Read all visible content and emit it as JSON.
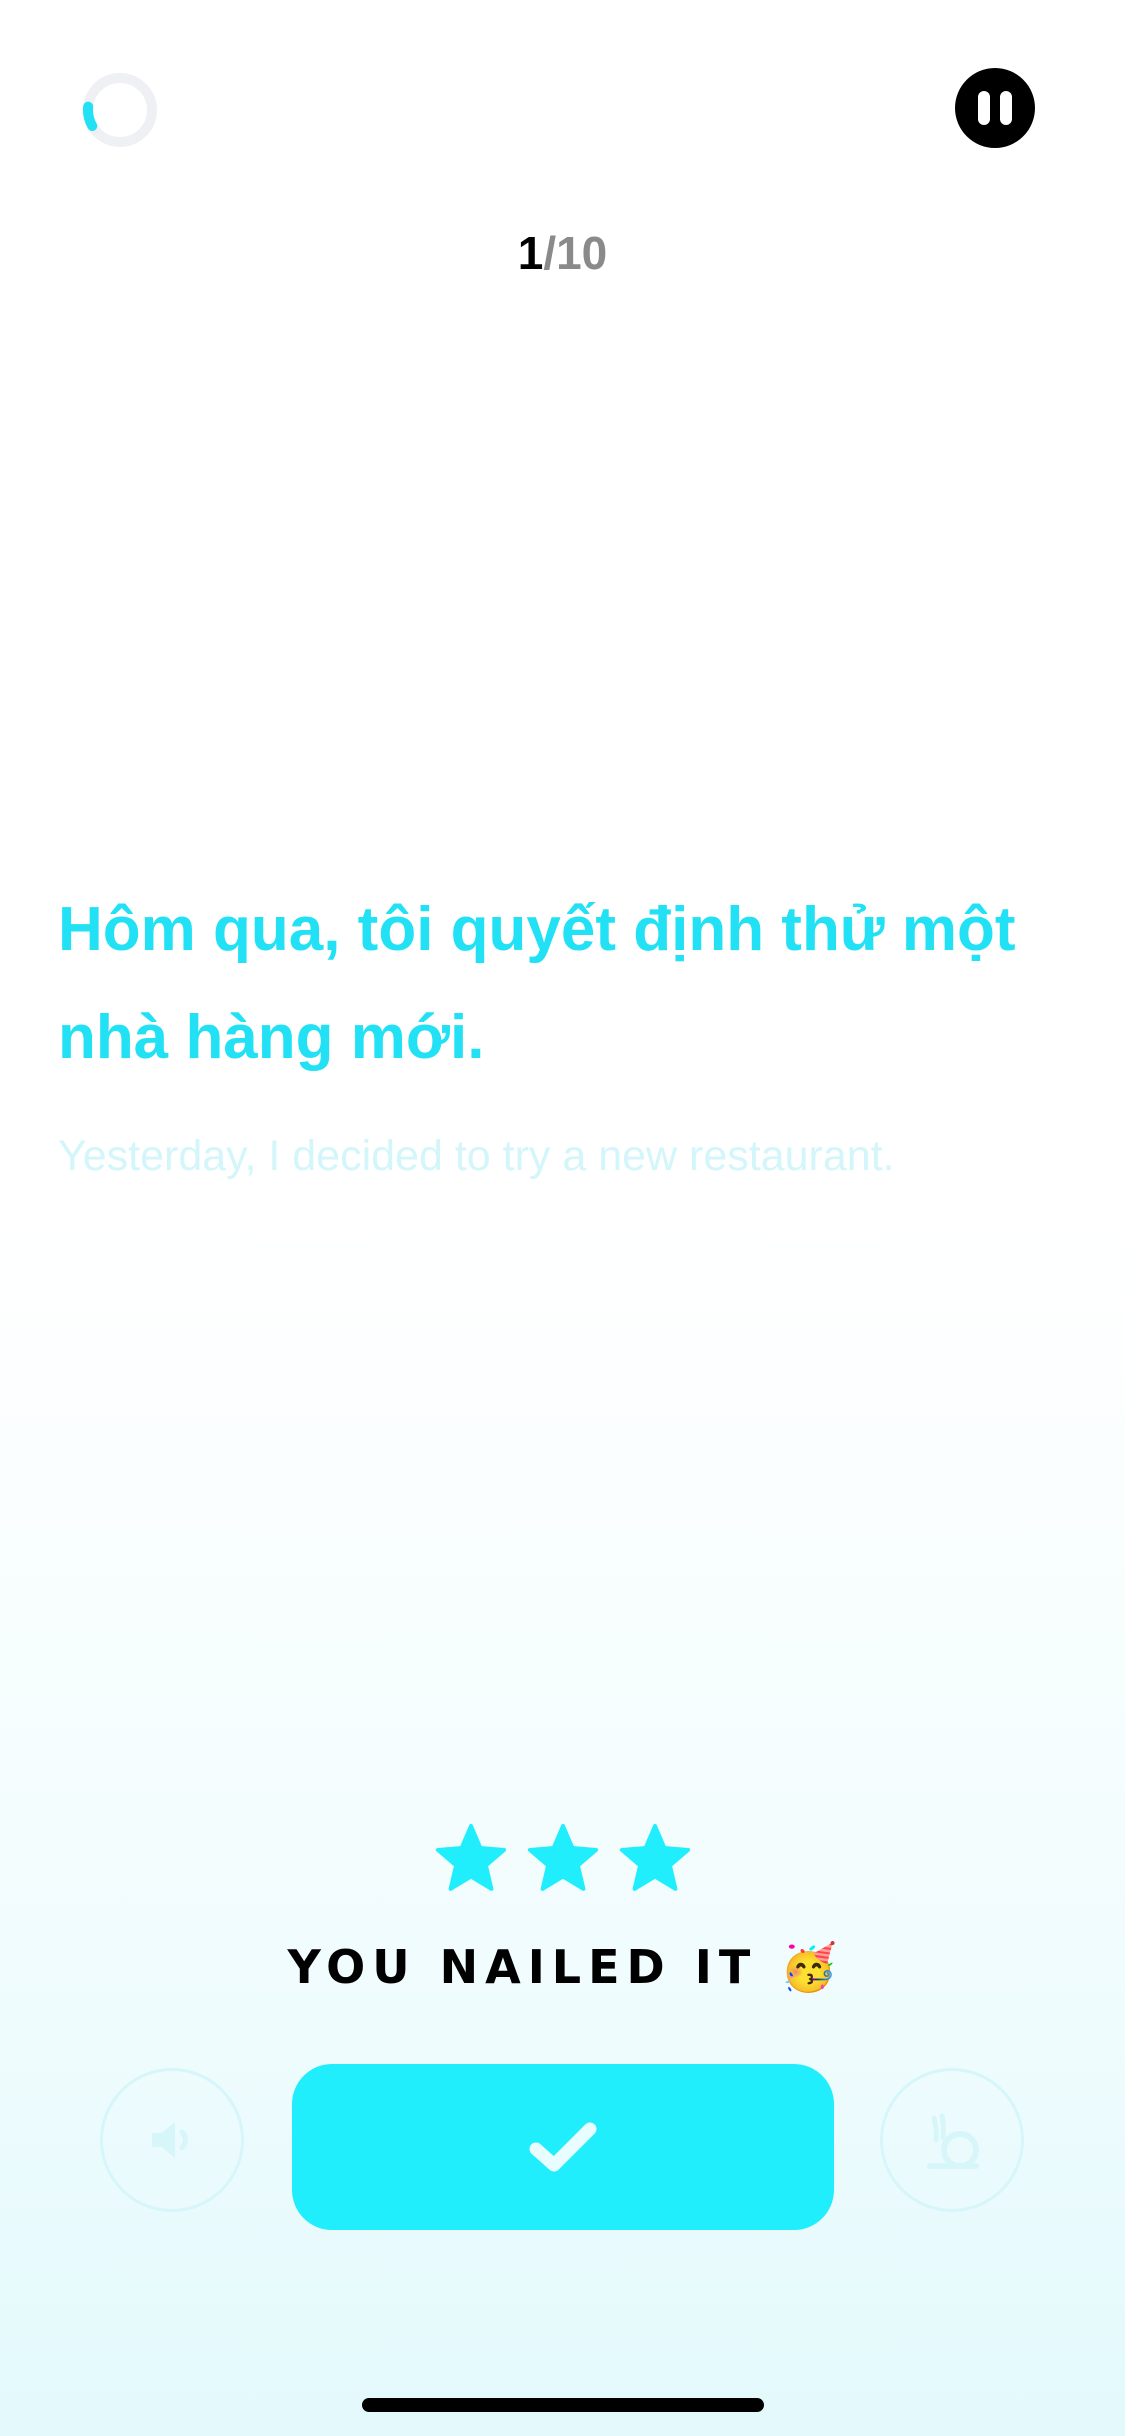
{
  "header": {
    "progress": 0.1,
    "current": "1",
    "separator": "/",
    "total": "10"
  },
  "sentence": {
    "text": "Hôm qua, tôi quyết định thử một nhà hàng mới.",
    "translation": "Yesterday, I decided to try a new restaurant."
  },
  "result": {
    "stars": 3,
    "message": "YOU NAILED IT",
    "emoji": "🥳"
  },
  "icons": {
    "progress": "progress-ring-icon",
    "pause": "pause-icon",
    "star": "star-icon",
    "audio": "speaker-icon",
    "slow": "snail-icon",
    "check": "checkmark-icon"
  },
  "colors": {
    "accent": "#21eefc",
    "sentence": "#22e1f5",
    "translation": "#d3f6fb",
    "progress_track": "#eef0f4"
  }
}
